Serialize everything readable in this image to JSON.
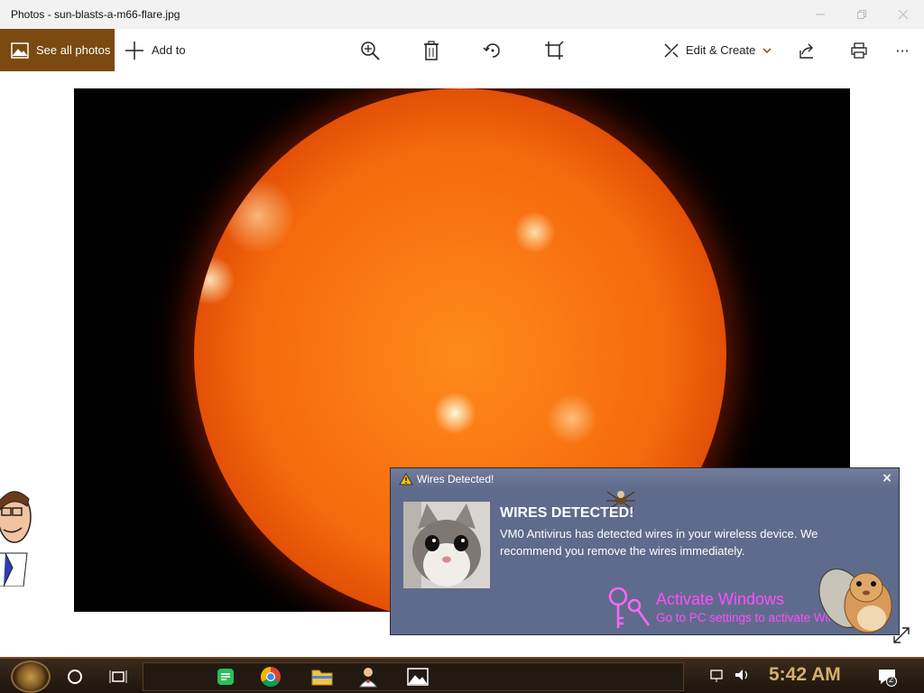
{
  "window": {
    "title": "Photos - sun-blasts-a-m66-flare.jpg"
  },
  "toolbar": {
    "see_all_label": "See all photos",
    "add_to_label": "Add to",
    "edit_create_label": "Edit & Create",
    "more_label": "···"
  },
  "popup": {
    "header": "Wires Detected!",
    "title": "WIRES DETECTED!",
    "message": "VM0 Antivirus has detected wires in your wireless device. We recommend you remove the wires immediately.",
    "close_label": "×"
  },
  "watermark": {
    "line1": "Activate Windows",
    "line2": "Go to PC settings to activate Windows."
  },
  "taskbar": {
    "clock": "5:42 AM",
    "notification_count": "2"
  },
  "colors": {
    "accent": "#7a4a10",
    "popup_bg": "#5f6b8c",
    "watermark": "#ff4dff",
    "clock": "#d4b16a"
  }
}
